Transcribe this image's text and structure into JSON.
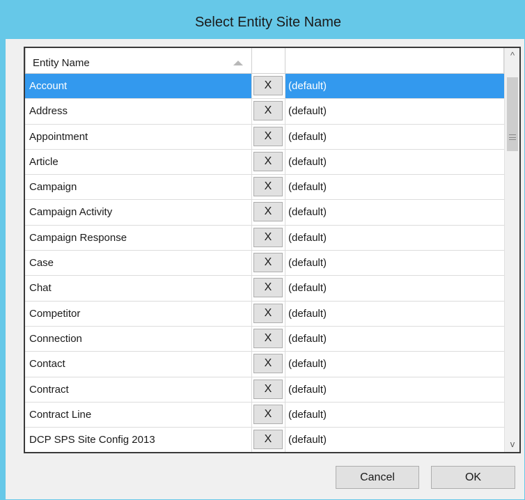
{
  "dialog": {
    "title": "Select Entity Site Name"
  },
  "grid": {
    "columns": {
      "name": "Entity Name",
      "clear": "",
      "value": ""
    },
    "clear_label": "X",
    "rows": [
      {
        "name": "Account",
        "value": "(default)",
        "selected": true
      },
      {
        "name": "Address",
        "value": "(default)"
      },
      {
        "name": "Appointment",
        "value": "(default)"
      },
      {
        "name": "Article",
        "value": "(default)"
      },
      {
        "name": "Campaign",
        "value": "(default)"
      },
      {
        "name": "Campaign Activity",
        "value": "(default)"
      },
      {
        "name": "Campaign Response",
        "value": "(default)"
      },
      {
        "name": "Case",
        "value": "(default)"
      },
      {
        "name": "Chat",
        "value": "(default)"
      },
      {
        "name": "Competitor",
        "value": "(default)"
      },
      {
        "name": "Connection",
        "value": "(default)"
      },
      {
        "name": "Contact",
        "value": "(default)"
      },
      {
        "name": "Contract",
        "value": "(default)"
      },
      {
        "name": "Contract Line",
        "value": "(default)"
      },
      {
        "name": "DCP SPS Site Config 2013",
        "value": "(default)"
      }
    ],
    "scroll": {
      "up_glyph": "^",
      "down_glyph": "v",
      "position_fraction": 0.04
    }
  },
  "buttons": {
    "cancel_label": "Cancel",
    "ok_label": "OK"
  },
  "colors": {
    "title_bar": "#66c8e8",
    "selection": "#3399ee"
  }
}
